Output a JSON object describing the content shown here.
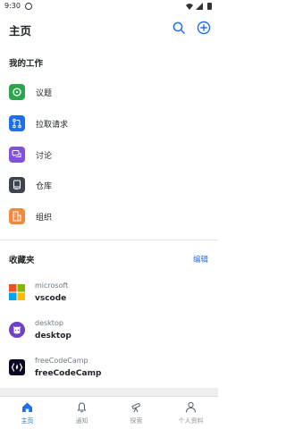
{
  "status_bar": {
    "time": "9:30"
  },
  "header": {
    "title": "主页"
  },
  "my_work": {
    "title": "我的工作",
    "items": [
      {
        "label": "议题",
        "icon": "issue-icon",
        "color": "#2da44e"
      },
      {
        "label": "拉取请求",
        "icon": "pull-request-icon",
        "color": "#1f6feb"
      },
      {
        "label": "讨论",
        "icon": "discussion-icon",
        "color": "#8250df"
      },
      {
        "label": "仓库",
        "icon": "repository-icon",
        "color": "#3d444d"
      },
      {
        "label": "组织",
        "icon": "organization-icon",
        "color": "#f0883e"
      }
    ]
  },
  "favorites": {
    "title": "收藏夹",
    "edit_label": "编辑",
    "items": [
      {
        "owner": "microsoft",
        "name": "vscode",
        "icon": "microsoft-logo-icon"
      },
      {
        "owner": "desktop",
        "name": "desktop",
        "icon": "github-logo-icon"
      },
      {
        "owner": "freeCodeCamp",
        "name": "freeCodeCamp",
        "icon": "freecodecamp-logo-icon"
      }
    ]
  },
  "bottom_nav": {
    "items": [
      {
        "label": "主页",
        "icon": "home-icon",
        "active": true
      },
      {
        "label": "通知",
        "icon": "bell-icon",
        "active": false
      },
      {
        "label": "探索",
        "icon": "telescope-icon",
        "active": false
      },
      {
        "label": "个人资料",
        "icon": "person-icon",
        "active": false
      }
    ]
  },
  "colors": {
    "accent": "#1f6feb",
    "text": "#1f2328",
    "muted": "#6e7781"
  }
}
